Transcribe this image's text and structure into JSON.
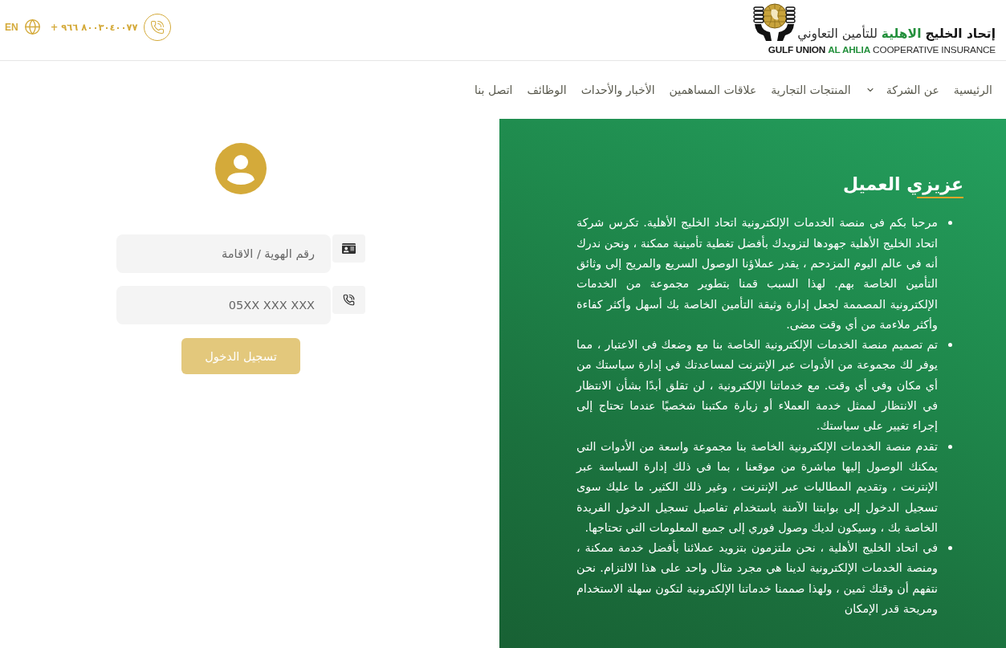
{
  "header": {
    "language": "EN",
    "phone": "+ ٩٦٦ ٨٠٠٣٠٤٠٠٧٧",
    "logo": {
      "name_ar": [
        {
          "text": "إتحاد الخليج",
          "kind": "dark"
        },
        {
          "text": "الاهلية",
          "kind": "accent"
        },
        {
          "text": "للتأمين التعاوني",
          "kind": "light"
        }
      ],
      "name_en": {
        "lead": "GULF UNION",
        "highlight": "AL AHLIA",
        "tail": "COOPERATIVE INSURANCE"
      }
    }
  },
  "nav": {
    "items": [
      {
        "label": "الرئيسية",
        "dropdown": false
      },
      {
        "label": "عن الشركة",
        "dropdown": true
      },
      {
        "label": "المنتجات التجارية",
        "dropdown": false
      },
      {
        "label": "علاقات المساهمين",
        "dropdown": false
      },
      {
        "label": "الأخبار والأحداث",
        "dropdown": false
      },
      {
        "label": "الوظائف",
        "dropdown": false
      },
      {
        "label": "اتصل بنا",
        "dropdown": false
      }
    ]
  },
  "login": {
    "fields": [
      {
        "kind": "id",
        "placeholder": "رقم الهوية / الاقامة"
      },
      {
        "kind": "phone",
        "placeholder": "05XX XXX XXX"
      }
    ],
    "button": {
      "label": "تسجيل الدخول",
      "disabled": true
    }
  },
  "welcome": {
    "title": "عزيزي العميل",
    "paragraphs": [
      "مرحبا بكم في منصة الخدمات الإلكترونية اتحاد الخليج الأهلية. تكرس شركة اتحاد الخليج الأهلية جهودها لتزويدك بأفضل تغطية تأمينية ممكنة ، ونحن ندرك أنه في عالم اليوم المزدحم ، يقدر عملاؤنا الوصول السريع والمريح إلى وثائق التأمين الخاصة بهم. لهذا السبب قمنا بتطوير مجموعة من الخدمات الإلكترونية المصممة لجعل إدارة وثيقة التأمين الخاصة بك أسهل وأكثر كفاءة وأكثر ملاءمة من أي وقت مضى.",
      "تم تصميم منصة الخدمات الإلكترونية الخاصة بنا مع وضعك في الاعتبار ، مما يوفر لك مجموعة من الأدوات عبر الإنترنت لمساعدتك في إدارة سياستك من أي مكان وفي أي وقت. مع خدماتنا الإلكترونية ، لن تقلق أبدًا بشأن الانتظار في الانتظار لممثل خدمة العملاء أو زيارة مكتبنا شخصيًا عندما تحتاج إلى إجراء تغيير على سياستك.",
      "تقدم منصة الخدمات الإلكترونية الخاصة بنا مجموعة واسعة من الأدوات التي يمكنك الوصول إليها مباشرة من موقعنا ، بما في ذلك إدارة السياسة عبر الإنترنت ، وتقديم المطالبات عبر الإنترنت ، وغير ذلك الكثير. ما عليك سوى تسجيل الدخول إلى بوابتنا الآمنة باستخدام تفاصيل تسجيل الدخول الفريدة الخاصة بك ، وسيكون لديك وصول فوري إلى جميع المعلومات التي تحتاجها.",
      "في اتحاد الخليج الأهلية ، نحن ملتزمون بتزويد عملائنا بأفضل خدمة ممكنة ، ومنصة الخدمات الإلكترونية لدينا هي مجرد مثال واحد على هذا الالتزام. نحن نتفهم أن وقتك ثمين ، ولهذا صممنا خدماتنا الإلكترونية لتكون سهلة الاستخدام ومريحة قدر الإمكان"
    ]
  }
}
